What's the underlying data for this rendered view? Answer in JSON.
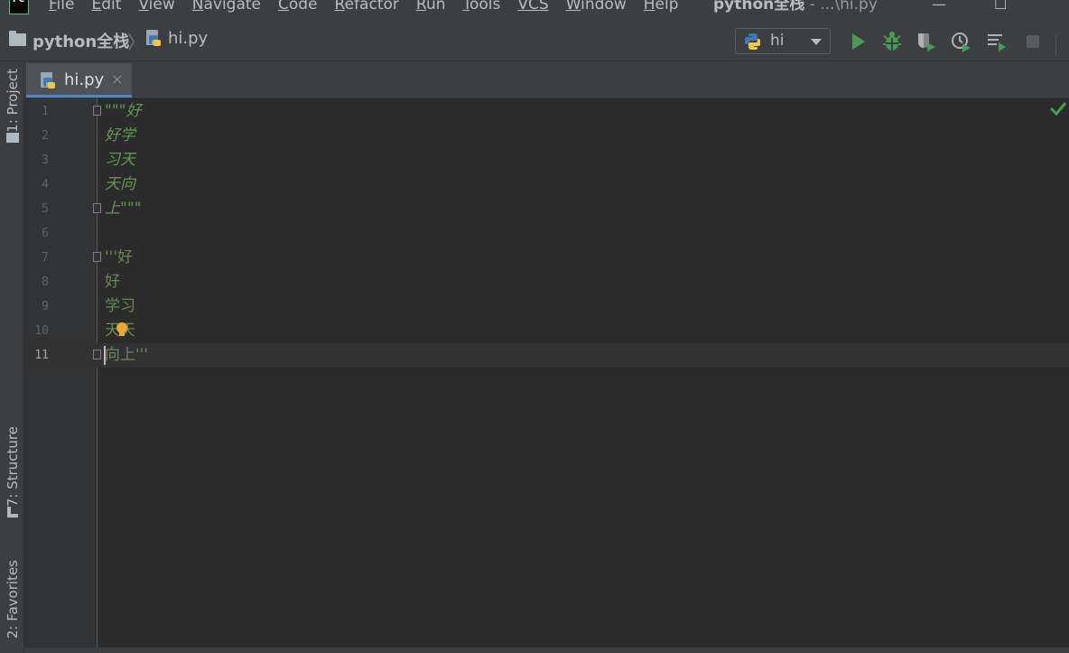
{
  "menu": {
    "items": [
      {
        "mnemonic": "F",
        "rest": "ile"
      },
      {
        "mnemonic": "E",
        "rest": "dit"
      },
      {
        "mnemonic": "V",
        "rest": "iew"
      },
      {
        "mnemonic": "N",
        "rest": "avigate"
      },
      {
        "mnemonic": "C",
        "rest": "ode"
      },
      {
        "mnemonic": "R",
        "rest": "efactor"
      },
      {
        "mnemonic": "R",
        "rest": "un"
      },
      {
        "mnemonic": "T",
        "rest": "ools"
      },
      {
        "mnemonic": "",
        "rest": "VCS"
      },
      {
        "mnemonic": "W",
        "rest": "indow"
      },
      {
        "mnemonic": "H",
        "rest": "elp"
      }
    ],
    "window_title_project": "python全栈",
    "window_title_rest": " - ...\\hi.py",
    "minimize_glyph": "—",
    "maximize_glyph": "☐"
  },
  "breadcrumb": {
    "project": "python全栈",
    "separator": "〉",
    "file": "hi.py"
  },
  "toolbar": {
    "run_config": "hi"
  },
  "left_strip": {
    "project_tab": "1: Project",
    "structure_tab": "7: Structure",
    "favorites_tab": "2: Favorites"
  },
  "tabs": [
    {
      "label": "hi.py",
      "close": "×"
    }
  ],
  "editor": {
    "lines": [
      {
        "num": "1",
        "text": "\"\"\"好"
      },
      {
        "num": "2",
        "text": "好学"
      },
      {
        "num": "3",
        "text": "习天"
      },
      {
        "num": "4",
        "text": "天向"
      },
      {
        "num": "5",
        "text": "上\"\"\""
      },
      {
        "num": "6",
        "text": ""
      },
      {
        "num": "7",
        "text": "'''好"
      },
      {
        "num": "8",
        "text": "好"
      },
      {
        "num": "9",
        "text": "学习"
      },
      {
        "num": "10",
        "text": "天天"
      },
      {
        "num": "11",
        "text": "向上'''"
      }
    ],
    "current_line": "11"
  },
  "colors": {
    "background": "#2b2b2b",
    "panel": "#3c3f41",
    "docstring": "#629755",
    "string": "#6a8759",
    "tab_underline": "#4a88c7",
    "run_green": "#499c54"
  },
  "icons": [
    "app-logo-icon",
    "folder-icon",
    "python-file-icon",
    "python-icon",
    "dropdown-arrow-icon",
    "run-icon",
    "debug-icon",
    "coverage-icon",
    "profile-icon",
    "run-list-icon",
    "stop-icon",
    "lightbulb-icon",
    "check-icon"
  ]
}
